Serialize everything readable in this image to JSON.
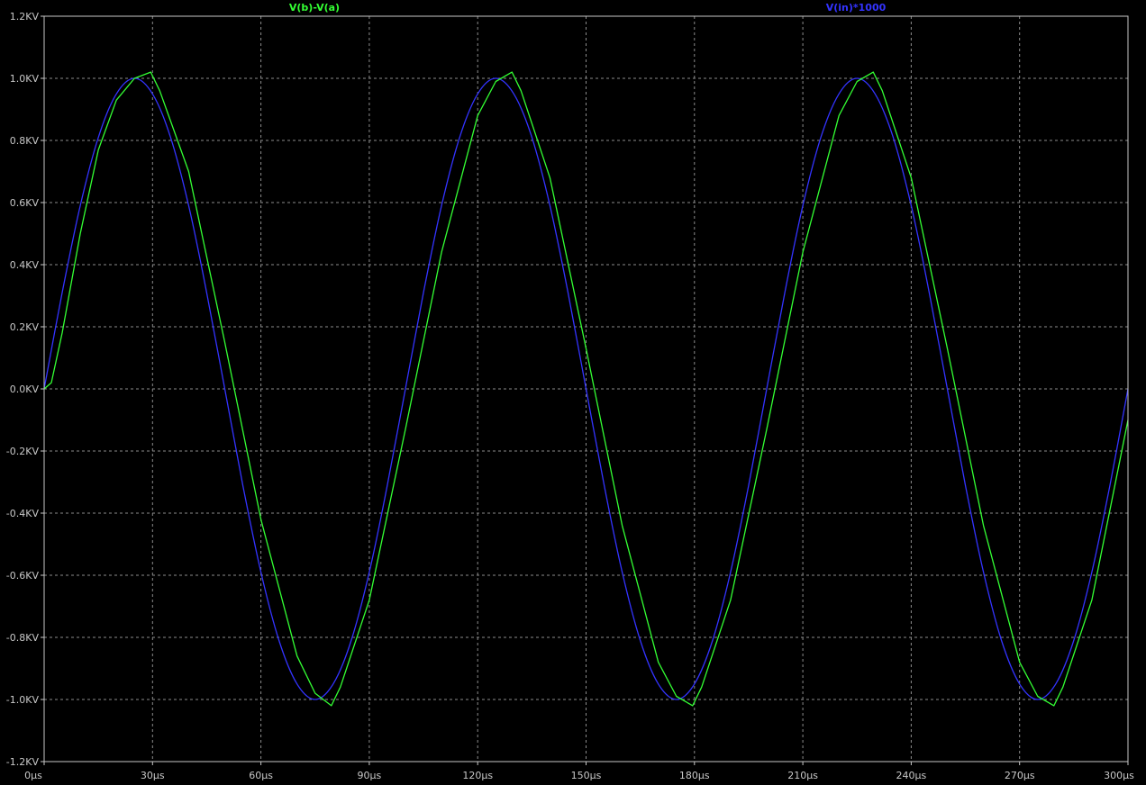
{
  "colors": {
    "background": "#000000",
    "grid": "#8c8c8c",
    "axis": "#c8c8c8",
    "series_green": "#33ff33",
    "series_blue": "#3333ff"
  },
  "chart_data": {
    "type": "line",
    "title": "",
    "xlabel": "",
    "ylabel": "",
    "xlim": [
      0,
      300
    ],
    "ylim": [
      -1.2,
      1.2
    ],
    "x_unit": "µs",
    "y_unit": "KV",
    "grid": true,
    "legend_placement": "top",
    "x_ticks": [
      "0µs",
      "30µs",
      "60µs",
      "90µs",
      "120µs",
      "150µs",
      "180µs",
      "210µs",
      "240µs",
      "270µs",
      "300µs"
    ],
    "y_ticks": [
      "1.2KV",
      "1.0KV",
      "0.8KV",
      "0.6KV",
      "0.4KV",
      "0.2KV",
      "0.0KV",
      "-0.2KV",
      "-0.4KV",
      "-0.6KV",
      "-0.8KV",
      "-1.0KV",
      "-1.2KV"
    ],
    "series": [
      {
        "name": "V(b)-V(a)",
        "color": "#33ff33",
        "x": [
          0,
          2,
          5,
          10,
          15,
          20,
          25,
          29.5,
          32,
          40,
          50,
          60,
          70,
          75,
          79.5,
          82,
          90,
          100,
          110,
          120,
          125,
          129.5,
          132,
          140,
          150,
          160,
          170,
          175,
          179.5,
          182,
          190,
          200,
          210,
          220,
          225,
          229.5,
          232,
          240,
          250,
          260,
          270,
          275,
          279.5,
          282,
          290,
          300
        ],
        "y": [
          0,
          0.02,
          0.18,
          0.5,
          0.77,
          0.93,
          1.0,
          1.02,
          0.96,
          0.7,
          0.15,
          -0.42,
          -0.86,
          -0.98,
          -1.02,
          -0.96,
          -0.68,
          -0.13,
          0.44,
          0.88,
          0.99,
          1.02,
          0.96,
          0.68,
          0.13,
          -0.44,
          -0.88,
          -0.99,
          -1.02,
          -0.96,
          -0.68,
          -0.13,
          0.44,
          0.88,
          0.99,
          1.02,
          0.96,
          0.68,
          0.13,
          -0.44,
          -0.88,
          -0.99,
          -1.02,
          -0.96,
          -0.68,
          -0.1
        ]
      },
      {
        "name": "V(in)*1000",
        "color": "#3333ff",
        "x": [
          0,
          5,
          10,
          15,
          20,
          25,
          30,
          35,
          40,
          45,
          50,
          55,
          60,
          65,
          70,
          75,
          80,
          85,
          90,
          95,
          100,
          105,
          110,
          115,
          120,
          125,
          130,
          135,
          140,
          145,
          150,
          155,
          160,
          165,
          170,
          175,
          180,
          185,
          190,
          195,
          200,
          205,
          210,
          215,
          220,
          225,
          230,
          235,
          240,
          245,
          250,
          255,
          260,
          265,
          270,
          275,
          280,
          285,
          290,
          295,
          300
        ],
        "y": [
          0,
          0.31,
          0.59,
          0.81,
          0.95,
          1.0,
          0.95,
          0.81,
          0.59,
          0.31,
          0,
          -0.31,
          -0.59,
          -0.81,
          -0.95,
          -1.0,
          -0.95,
          -0.81,
          -0.59,
          -0.31,
          0,
          0.31,
          0.59,
          0.81,
          0.95,
          1.0,
          0.95,
          0.81,
          0.59,
          0.31,
          0,
          -0.31,
          -0.59,
          -0.81,
          -0.95,
          -1.0,
          -0.95,
          -0.81,
          -0.59,
          -0.31,
          0,
          0.31,
          0.59,
          0.81,
          0.95,
          1.0,
          0.95,
          0.81,
          0.59,
          0.31,
          0,
          -0.31,
          -0.59,
          -0.81,
          -0.95,
          -1.0,
          -0.95,
          -0.81,
          -0.59,
          -0.31,
          0
        ]
      }
    ]
  }
}
